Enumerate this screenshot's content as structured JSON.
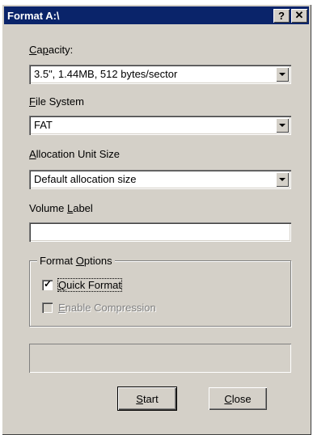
{
  "window": {
    "title": "Format A:\\",
    "help_label": "?",
    "close_label": "✕"
  },
  "capacity": {
    "label": "Capacity:",
    "value": "3.5\",  1.44MB, 512 bytes/sector"
  },
  "file_system": {
    "label": "File System",
    "value": "FAT"
  },
  "allocation": {
    "label": "Allocation Unit Size",
    "value": "Default allocation size"
  },
  "volume_label": {
    "label": "Volume Label",
    "value": ""
  },
  "format_options": {
    "title": "Format Options",
    "quick_format": {
      "label": "Quick Format",
      "checked": true
    },
    "compression": {
      "label": "Enable Compression",
      "checked": false,
      "disabled": true
    }
  },
  "buttons": {
    "start": "Start",
    "close": "Close"
  }
}
